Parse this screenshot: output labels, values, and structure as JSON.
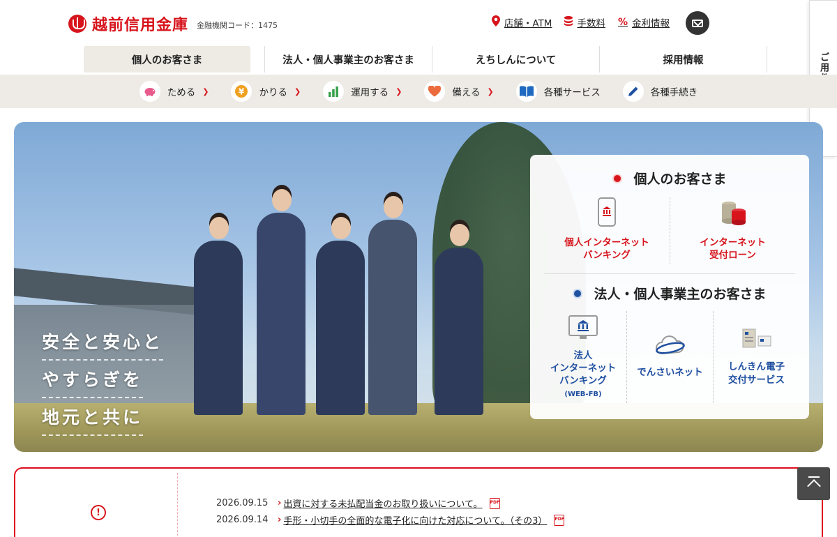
{
  "header": {
    "logo_text": "越前信用金庫",
    "institution_code": "金融機関コード：1475",
    "util_links": [
      {
        "label": "店舗・ATM",
        "icon": "map-pin-icon"
      },
      {
        "label": "手数料",
        "icon": "coins-icon"
      },
      {
        "label": "金利情報",
        "icon": "percent-icon"
      }
    ],
    "brand_color": "#d7141c"
  },
  "side_tab": {
    "label": "ご用件は？"
  },
  "main_nav": [
    {
      "label": "個人のお客さま",
      "active": true
    },
    {
      "label": "法人・個人事業主のお客さま"
    },
    {
      "label": "えちしんについて"
    },
    {
      "label": "採用情報"
    }
  ],
  "sub_nav": [
    {
      "label": "ためる",
      "icon": "piggy-bank-icon"
    },
    {
      "label": "かりる",
      "icon": "yen-coin-icon"
    },
    {
      "label": "運用する",
      "icon": "bar-chart-icon"
    },
    {
      "label": "備える",
      "icon": "heart-icon"
    },
    {
      "label": "各種サービス",
      "icon": "book-icon"
    },
    {
      "label": "各種手続き",
      "icon": "pen-icon"
    }
  ],
  "hero": {
    "catch_lines": [
      "安全と安心と",
      "やすらぎを",
      "地元と共に"
    ],
    "panel": {
      "personal_title": "個人のお客さま",
      "personal_items": [
        {
          "line1": "個人インターネット",
          "line2": "バンキング",
          "icon": "smartphone-bank-icon"
        },
        {
          "line1": "インターネット",
          "line2": "受付ローン",
          "icon": "coin-stack-icon"
        }
      ],
      "corporate_title": "法人・個人事業主のお客さま",
      "corporate_items": [
        {
          "line1": "法人",
          "line2": "インターネット",
          "line3": "バンキング",
          "sub": "(WEB-FB)",
          "icon": "monitor-bank-icon"
        },
        {
          "line1": "でんさいネット",
          "icon": "cloud-icon"
        },
        {
          "line1": "しんきん電子",
          "line2": "交付サービス",
          "icon": "document-icon"
        }
      ]
    }
  },
  "news": {
    "items": [
      {
        "date": "2026.09.15",
        "title": "出資に対する未払配当金のお取り扱いについて。",
        "pdf": "PDF"
      },
      {
        "date": "2026.09.14",
        "title": "手形・小切手の全面的な電子化に向けた対応について。（その3）",
        "pdf": "PDF"
      }
    ]
  }
}
